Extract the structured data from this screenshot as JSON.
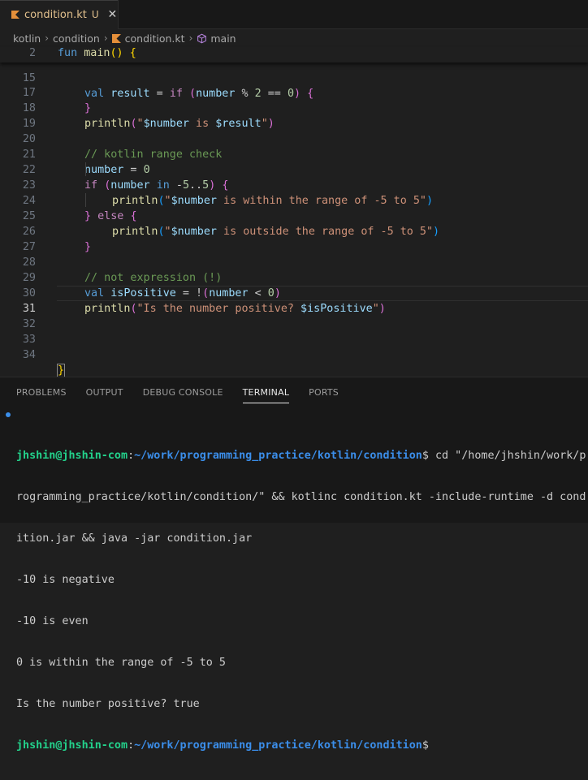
{
  "tab": {
    "title": "condition.kt",
    "status": "U",
    "close": "✕",
    "colors": {
      "modified": "#e2c08d"
    }
  },
  "breadcrumb": [
    "kotlin",
    "condition",
    "condition.kt",
    "main"
  ],
  "editor": {
    "sticky": {
      "ln": "2",
      "code": "fun main() {"
    },
    "lines": [
      {
        "ln": "15",
        "code": "val result = if (number % 2 == 0) {"
      },
      {
        "ln": "17",
        "code": "}"
      },
      {
        "ln": "18",
        "code": "println(\"$number is $result\")"
      },
      {
        "ln": "19",
        "code": ""
      },
      {
        "ln": "20",
        "code": "// kotlin range check"
      },
      {
        "ln": "21",
        "code": "number = 0"
      },
      {
        "ln": "22",
        "code": "if (number in -5..5) {"
      },
      {
        "ln": "23",
        "code": "println(\"$number is within the range of -5 to 5\")"
      },
      {
        "ln": "24",
        "code": "} else {"
      },
      {
        "ln": "25",
        "code": "println(\"$number is outside the range of -5 to 5\")"
      },
      {
        "ln": "26",
        "code": "}"
      },
      {
        "ln": "27",
        "code": ""
      },
      {
        "ln": "28",
        "code": "// not expression (!)"
      },
      {
        "ln": "29",
        "code": "val isPositive = !(number < 0)"
      },
      {
        "ln": "30",
        "code": "println(\"Is the number positive? $isPositive\")"
      },
      {
        "ln": "31",
        "code": ""
      },
      {
        "ln": "32",
        "code": ""
      },
      {
        "ln": "33",
        "code": ""
      },
      {
        "ln": "34",
        "code": "}"
      }
    ],
    "active_line": "31"
  },
  "panel": {
    "tabs": [
      "PROBLEMS",
      "OUTPUT",
      "DEBUG CONSOLE",
      "TERMINAL",
      "PORTS"
    ],
    "active_tab": "TERMINAL"
  },
  "terminal": {
    "prompt_user": "jhshin@jhshin-com",
    "prompt_sep": ":",
    "prompt_path": "~/work/programming_practice/kotlin/condition",
    "prompt_symbol": "$",
    "command_lines": [
      " cd \"/home/jhshin/work/p",
      "rogramming_practice/kotlin/condition/\" && kotlinc condition.kt -include-runtime -d cond",
      "ition.jar && java -jar condition.jar"
    ],
    "output": [
      "-10 is negative",
      "-10 is even",
      "0 is within the range of -5 to 5",
      "Is the number positive? true"
    ]
  }
}
